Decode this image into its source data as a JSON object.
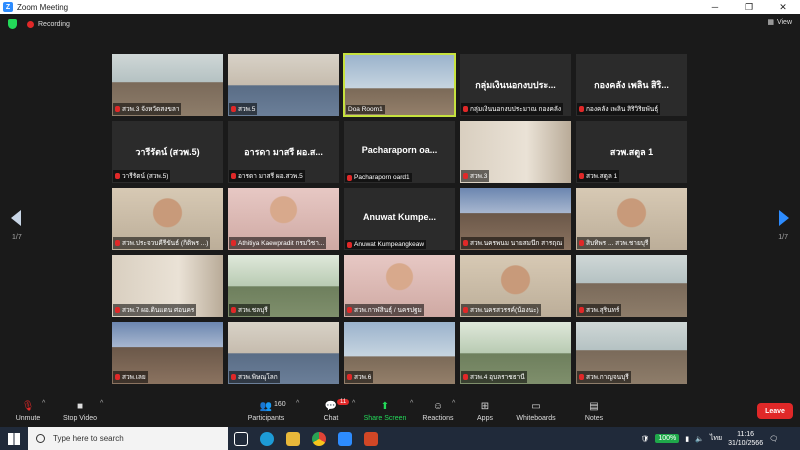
{
  "window": {
    "title": "Zoom Meeting",
    "controls": [
      "─",
      "❐",
      "✕"
    ]
  },
  "meeting": {
    "recording_label": "Recording",
    "view_label": "View",
    "page_indicator": "1/7"
  },
  "colors": {
    "accent": "#2d8cff",
    "recording": "#e02828",
    "active_speaker": "#c6e23e",
    "share_screen": "#23d959",
    "leave": "#e02828"
  },
  "participants": [
    {
      "label": "สวพ.3 จังหวัดสงขลา",
      "big_name": "",
      "scene": "room",
      "muted": true
    },
    {
      "label": "สวพ.5",
      "big_name": "",
      "scene": "office",
      "muted": true
    },
    {
      "label": "Doa Room1",
      "big_name": "",
      "scene": "blue",
      "muted": false,
      "active": true
    },
    {
      "label": "กลุ่มเงินนอกงบประมาณ กองคลัง",
      "big_name": "กลุ่มเงินนอกงบประ...",
      "scene": "",
      "muted": true
    },
    {
      "label": "กองคลัง เพลิน สิริวิริยพันธุ์",
      "big_name": "กองคลัง เพลิน สิริ...",
      "scene": "",
      "muted": true
    },
    {
      "label": "วารีรัตน์ (สวพ.5)",
      "big_name": "วารีรัตน์ (สวพ.5)",
      "scene": "",
      "muted": true
    },
    {
      "label": "อารดา มาสรี ผอ.สวพ.5",
      "big_name": "อารดา มาสรี ผอ.ส...",
      "scene": "",
      "muted": true
    },
    {
      "label": "Pacharaporn oard1",
      "big_name": "Pacharaporn oa...",
      "scene": "",
      "muted": true
    },
    {
      "label": "สวพ.3",
      "big_name": "",
      "scene": "wall",
      "muted": true
    },
    {
      "label": "สวพ.สตูล 1",
      "big_name": "สวพ.สตูล 1",
      "scene": "",
      "muted": true
    },
    {
      "label": "สวพ.ประจวบคีรีขันธ์ (กิติพร ...)",
      "big_name": "",
      "scene": "person",
      "muted": true
    },
    {
      "label": "Athitiya Kaewpradit กรมวิชา...",
      "big_name": "",
      "scene": "pink",
      "muted": true
    },
    {
      "label": "Anuwat Kumpeangkeaw",
      "big_name": "Anuwat Kumpe...",
      "scene": "",
      "muted": true
    },
    {
      "label": "สวพ.นครพนม นายสมนึก สารฤณ",
      "big_name": "",
      "scene": "poster",
      "muted": true
    },
    {
      "label": "สิบทิพร ... สวพ.ชายบุรี",
      "big_name": "",
      "scene": "person",
      "muted": true
    },
    {
      "label": "สวพ.7 ผอ.ดินแดน ศอนคร",
      "big_name": "",
      "scene": "wall",
      "muted": true
    },
    {
      "label": "สวพ.ชลบุรี",
      "big_name": "",
      "scene": "green",
      "muted": true
    },
    {
      "label": "สวพ.กาฬสินธุ์ / นครปฐม",
      "big_name": "",
      "scene": "pink",
      "muted": true
    },
    {
      "label": "สวพ.นครสวรรค์(น้องนะ)",
      "big_name": "",
      "scene": "person",
      "muted": true
    },
    {
      "label": "สวพ.สุรินทร์",
      "big_name": "",
      "scene": "room",
      "muted": true
    },
    {
      "label": "สวพ.เลย",
      "big_name": "",
      "scene": "poster",
      "muted": true
    },
    {
      "label": "สวพ.พิษณุโลก",
      "big_name": "",
      "scene": "office",
      "muted": true
    },
    {
      "label": "สวพ.6",
      "big_name": "",
      "scene": "blue",
      "muted": true
    },
    {
      "label": "สวพ.4 อุบลราชธานี",
      "big_name": "",
      "scene": "green",
      "muted": true
    },
    {
      "label": "สวพ.กาญจนบุรี",
      "big_name": "",
      "scene": "room",
      "muted": true
    }
  ],
  "toolbar": {
    "unmute": "Unmute",
    "stop_video": "Stop Video",
    "participants": "Participants",
    "participants_count": "160",
    "chat": "Chat",
    "chat_badge": "11",
    "share_screen": "Share Screen",
    "reactions": "Reactions",
    "apps": "Apps",
    "whiteboards": "Whiteboards",
    "notes": "Notes",
    "leave": "Leave"
  },
  "taskbar": {
    "search_placeholder": "Type here to search",
    "battery": "100%",
    "language": "ไทย",
    "time": "11:16",
    "date": "31/10/2566"
  }
}
